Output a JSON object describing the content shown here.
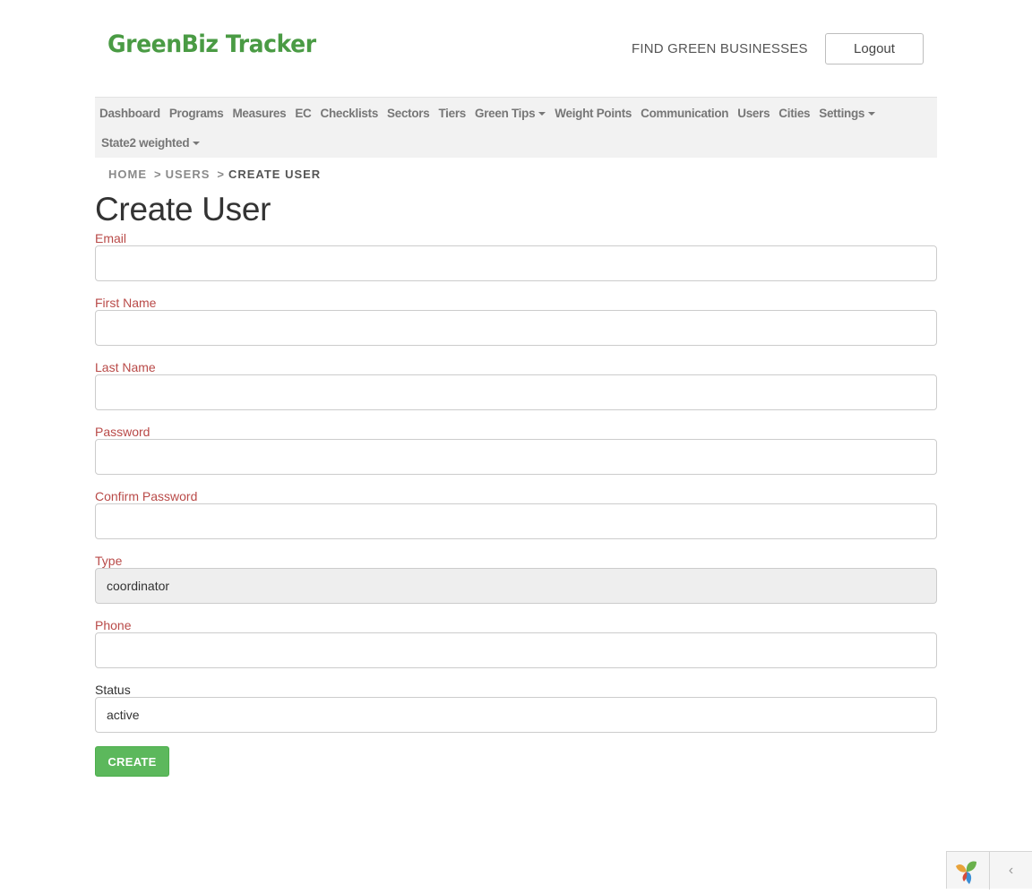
{
  "header": {
    "logo": "GreenBiz Tracker",
    "find_link": "FIND GREEN BUSINESSES",
    "logout": "Logout"
  },
  "nav": {
    "row1": [
      "Dashboard",
      "Programs",
      "Measures",
      "EC",
      "Checklists",
      "Sectors",
      "Tiers",
      "Green Tips",
      "Weight Points",
      "Communication",
      "Users",
      "Cities",
      "Settings"
    ],
    "row2": [
      "State2 weighted"
    ],
    "dropdowns": [
      "Green Tips",
      "Settings",
      "State2 weighted"
    ]
  },
  "breadcrumb": {
    "home": "HOME",
    "sep": ">",
    "users": "USERS",
    "current": "CREATE USER"
  },
  "page_title": "Create User",
  "form": {
    "email": {
      "label": "Email",
      "value": ""
    },
    "first_name": {
      "label": "First Name",
      "value": ""
    },
    "last_name": {
      "label": "Last Name",
      "value": ""
    },
    "password": {
      "label": "Password",
      "value": ""
    },
    "confirm_password": {
      "label": "Confirm Password",
      "value": ""
    },
    "type": {
      "label": "Type",
      "value": "coordinator"
    },
    "phone": {
      "label": "Phone",
      "value": ""
    },
    "status": {
      "label": "Status",
      "value": "active"
    },
    "submit": "CREATE"
  },
  "colors": {
    "brand_green": "#4a9b44",
    "button_green": "#5cb85c",
    "required_label": "#b94a48"
  },
  "debug_toolbar": {
    "logo_icon": "yii-logo-icon",
    "toggle_icon": "chevron-left-icon",
    "toggle_glyph": "‹"
  }
}
